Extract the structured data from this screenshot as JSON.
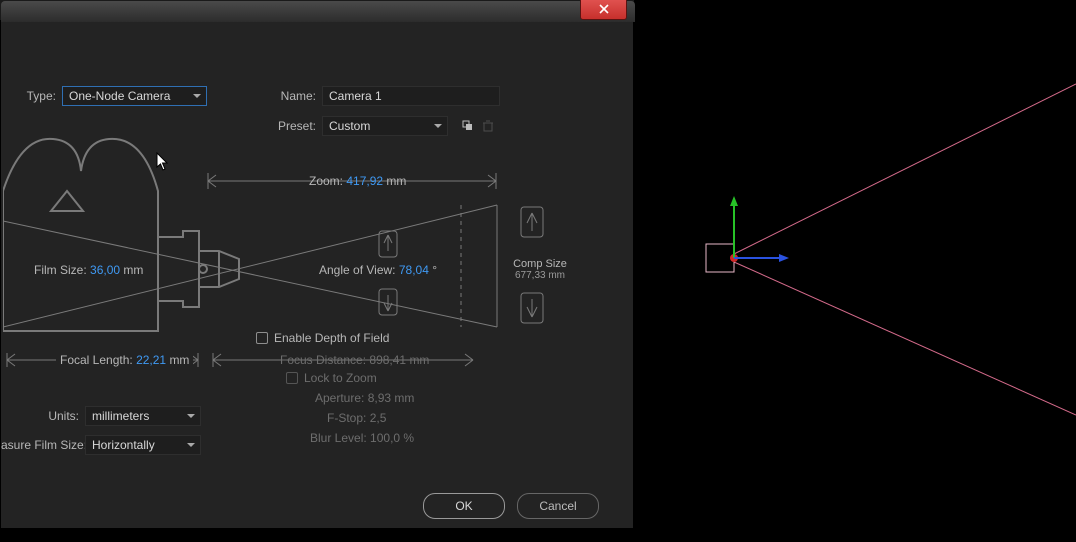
{
  "dialog": {
    "close_tooltip": "Close",
    "type_label": "Type:",
    "type_value": "One-Node Camera",
    "name_label": "Name:",
    "name_value": "Camera 1",
    "preset_label": "Preset:",
    "preset_value": "Custom",
    "diagram": {
      "zoom_label": "Zoom:",
      "zoom_value": "417,92",
      "zoom_unit": "mm",
      "film_size_label": "Film Size:",
      "film_size_value": "36,00",
      "film_size_unit": "mm",
      "angle_label": "Angle of View:",
      "angle_value": "78,04",
      "angle_unit": "°",
      "comp_size_label": "Comp Size",
      "comp_size_value": "677,33 mm",
      "focal_length_label": "Focal Length:",
      "focal_length_value": "22,21",
      "focal_length_unit": "mm"
    },
    "dof": {
      "enable_label": "Enable Depth of Field",
      "focus_distance_label": "Focus Distance:",
      "focus_distance_value": "898,41",
      "focus_distance_unit": "mm",
      "lock_label": "Lock to Zoom",
      "aperture_label": "Aperture:",
      "aperture_value": "8,93",
      "aperture_unit": "mm",
      "fstop_label": "F-Stop:",
      "fstop_value": "2,5",
      "blur_label": "Blur Level:",
      "blur_value": "100,0",
      "blur_unit": "%"
    },
    "units_label": "Units:",
    "units_value": "millimeters",
    "measure_label": "asure Film Size:",
    "measure_value": "Horizontally",
    "ok_label": "OK",
    "cancel_label": "Cancel"
  }
}
